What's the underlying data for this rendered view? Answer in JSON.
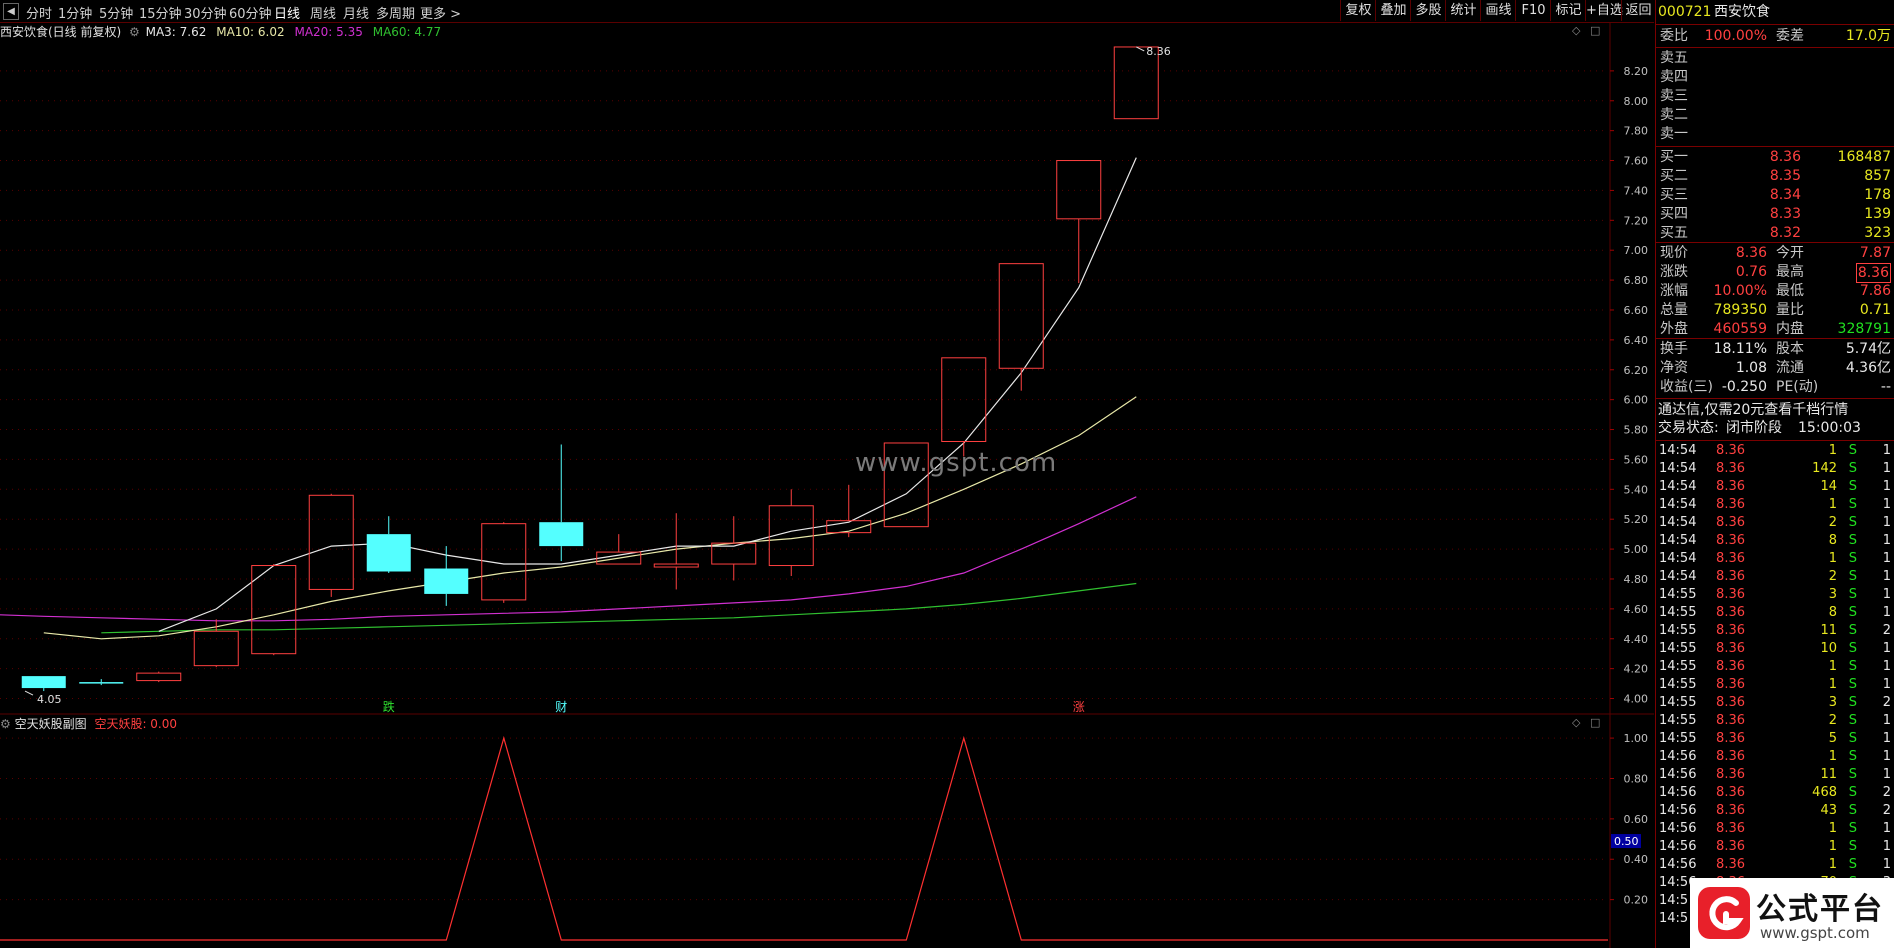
{
  "toolbar": {
    "periods": [
      "分时",
      "1分钟",
      "5分钟",
      "15分钟",
      "30分钟",
      "60分钟",
      "日线",
      "周线",
      "月线",
      "多周期",
      "更多 >"
    ],
    "actions": [
      "复权",
      "叠加",
      "多股",
      "统计",
      "画线",
      "F10",
      "标记",
      "+自选",
      "返回"
    ]
  },
  "chart": {
    "stock_title": "西安饮食(日线 前复权)",
    "ma3_label": "MA3: 7.62",
    "ma10_label": "MA10: 6.02",
    "ma20_label": "MA20: 5.35",
    "ma60_label": "MA60: 4.77",
    "high_marker": "8.36",
    "low_marker": "4.05",
    "event_labels": [
      "跌",
      "财",
      "涨"
    ],
    "y_ticks": [
      "8.20",
      "8.00",
      "7.80",
      "7.60",
      "7.40",
      "7.20",
      "7.00",
      "6.80",
      "6.60",
      "6.40",
      "6.20",
      "6.00",
      "5.80",
      "5.60",
      "5.40",
      "5.20",
      "5.00",
      "4.80",
      "4.60",
      "4.40",
      "4.20",
      "4.00"
    ],
    "colors": {
      "up": "#ff4040",
      "down": "#54ffff",
      "ma3": "#e8e8e8",
      "ma10": "#e8e8a8",
      "ma20": "#d030d0",
      "ma60": "#30c030",
      "grid": "#5a0000"
    }
  },
  "indicator": {
    "title": "空天妖股副图",
    "series_label": "空天妖股: 0.00",
    "y_ticks": [
      "1.00",
      "0.80",
      "0.60",
      "0.40",
      "0.20"
    ],
    "cursor_value": "0.50"
  },
  "watermark": "www.gspt.com",
  "logo": {
    "text": "公式平台",
    "url": "www.gspt.com"
  },
  "chart_data": [
    {
      "type": "candlestick",
      "title": "西安饮食(日线 前复权)",
      "candles": [
        {
          "o": 4.15,
          "h": 4.15,
          "l": 4.05,
          "c": 4.07
        },
        {
          "o": 4.11,
          "h": 4.13,
          "l": 4.09,
          "c": 4.1
        },
        {
          "o": 4.12,
          "h": 4.18,
          "l": 4.11,
          "c": 4.17
        },
        {
          "o": 4.22,
          "h": 4.53,
          "l": 4.21,
          "c": 4.45
        },
        {
          "o": 4.3,
          "h": 4.9,
          "l": 4.29,
          "c": 4.89
        },
        {
          "o": 4.73,
          "h": 5.37,
          "l": 4.68,
          "c": 5.36
        },
        {
          "o": 5.1,
          "h": 5.22,
          "l": 4.84,
          "c": 4.85
        },
        {
          "o": 4.87,
          "h": 5.02,
          "l": 4.62,
          "c": 4.7
        },
        {
          "o": 4.66,
          "h": 5.18,
          "l": 4.64,
          "c": 5.17
        },
        {
          "o": 5.18,
          "h": 5.7,
          "l": 4.92,
          "c": 5.02
        },
        {
          "o": 4.9,
          "h": 5.1,
          "l": 4.9,
          "c": 4.98
        },
        {
          "o": 4.88,
          "h": 5.24,
          "l": 4.73,
          "c": 4.9
        },
        {
          "o": 4.9,
          "h": 5.22,
          "l": 4.79,
          "c": 5.04
        },
        {
          "o": 4.89,
          "h": 5.4,
          "l": 4.82,
          "c": 5.29
        },
        {
          "o": 5.11,
          "h": 5.43,
          "l": 5.08,
          "c": 5.19
        },
        {
          "o": 5.15,
          "h": 5.71,
          "l": 5.15,
          "c": 5.71
        },
        {
          "o": 5.72,
          "h": 6.28,
          "l": 5.62,
          "c": 6.28
        },
        {
          "o": 6.21,
          "h": 6.91,
          "l": 6.06,
          "c": 6.91
        },
        {
          "o": 7.21,
          "h": 7.6,
          "l": 6.78,
          "c": 7.6
        },
        {
          "o": 7.88,
          "h": 8.36,
          "l": 7.88,
          "c": 8.36
        }
      ],
      "ma3": [
        4.45,
        4.6,
        4.89,
        5.02,
        5.04,
        4.96,
        4.9,
        4.9,
        4.96,
        5.02,
        5.02,
        5.12,
        5.18,
        5.37,
        5.71,
        6.18,
        6.75,
        7.62
      ],
      "ma10": [
        4.44,
        4.4,
        4.42,
        4.48,
        4.56,
        4.65,
        4.72,
        4.78,
        4.84,
        4.88,
        4.94,
        5.0,
        5.04,
        5.07,
        5.12,
        5.24,
        5.4,
        5.57,
        5.76,
        6.02
      ],
      "ma20": [
        4.56,
        4.55,
        4.54,
        4.53,
        4.52,
        4.52,
        4.53,
        4.55,
        4.56,
        4.57,
        4.58,
        4.6,
        4.62,
        4.64,
        4.66,
        4.7,
        4.75,
        4.84,
        5.0,
        5.17,
        5.35
      ],
      "ma60": [
        4.44,
        4.45,
        4.46,
        4.46,
        4.47,
        4.48,
        4.49,
        4.5,
        4.51,
        4.52,
        4.53,
        4.54,
        4.56,
        4.58,
        4.6,
        4.63,
        4.67,
        4.72,
        4.77
      ],
      "ylim": [
        3.95,
        8.42
      ]
    },
    {
      "type": "line",
      "title": "空天妖股副图",
      "series": [
        {
          "name": "空天妖股",
          "values": [
            0,
            0,
            0,
            0,
            0,
            0,
            0,
            0,
            1,
            0,
            0,
            0,
            0,
            0,
            0,
            0,
            1,
            0,
            0,
            0
          ]
        }
      ],
      "ylim": [
        0,
        1.05
      ]
    }
  ],
  "panel": {
    "code": "000721",
    "name": "西安饮食",
    "weibi_label": "委比",
    "weibi_value": "100.00%",
    "weicha_label": "委差",
    "weicha_value": "17.0万",
    "sells": [
      {
        "label": "卖五",
        "price": "",
        "vol": ""
      },
      {
        "label": "卖四",
        "price": "",
        "vol": ""
      },
      {
        "label": "卖三",
        "price": "",
        "vol": ""
      },
      {
        "label": "卖二",
        "price": "",
        "vol": ""
      },
      {
        "label": "卖一",
        "price": "",
        "vol": ""
      }
    ],
    "buys": [
      {
        "label": "买一",
        "price": "8.36",
        "vol": "168487"
      },
      {
        "label": "买二",
        "price": "8.35",
        "vol": "857"
      },
      {
        "label": "买三",
        "price": "8.34",
        "vol": "178"
      },
      {
        "label": "买四",
        "price": "8.33",
        "vol": "139"
      },
      {
        "label": "买五",
        "price": "8.32",
        "vol": "323"
      }
    ],
    "quote": [
      {
        "l1": "现价",
        "v1": "8.36",
        "l2": "今开",
        "v2": "7.87",
        "c1": "red",
        "c2": "red"
      },
      {
        "l1": "涨跌",
        "v1": "0.76",
        "l2": "最高",
        "v2": "8.36",
        "c1": "red",
        "c2": "red"
      },
      {
        "l1": "涨幅",
        "v1": "10.00%",
        "l2": "最低",
        "v2": "7.86",
        "c1": "red",
        "c2": "red"
      },
      {
        "l1": "总量",
        "v1": "789350",
        "l2": "量比",
        "v2": "0.71",
        "c1": "yellow",
        "c2": "yellow"
      },
      {
        "l1": "外盘",
        "v1": "460559",
        "l2": "内盘",
        "v2": "328791",
        "c1": "red",
        "c2": "green"
      }
    ],
    "fund": [
      {
        "l1": "换手",
        "v1": "18.11%",
        "l2": "股本",
        "v2": "5.74亿"
      },
      {
        "l1": "净资",
        "v1": "1.08",
        "l2": "流通",
        "v2": "4.36亿"
      },
      {
        "l1": "收益(三)",
        "v1": "-0.250",
        "l2": "PE(动)",
        "v2": "--"
      }
    ],
    "promo": "通达信,仅需20元查看千档行情",
    "trade_status_label": "交易状态:",
    "trade_status": "闭市阶段",
    "trade_time": "15:00:03",
    "ticks": [
      {
        "t": "14:54",
        "p": "8.36",
        "v": "1",
        "s": "S",
        "n": "1"
      },
      {
        "t": "14:54",
        "p": "8.36",
        "v": "142",
        "s": "S",
        "n": "1"
      },
      {
        "t": "14:54",
        "p": "8.36",
        "v": "14",
        "s": "S",
        "n": "1"
      },
      {
        "t": "14:54",
        "p": "8.36",
        "v": "1",
        "s": "S",
        "n": "1"
      },
      {
        "t": "14:54",
        "p": "8.36",
        "v": "2",
        "s": "S",
        "n": "1"
      },
      {
        "t": "14:54",
        "p": "8.36",
        "v": "8",
        "s": "S",
        "n": "1"
      },
      {
        "t": "14:54",
        "p": "8.36",
        "v": "1",
        "s": "S",
        "n": "1"
      },
      {
        "t": "14:54",
        "p": "8.36",
        "v": "2",
        "s": "S",
        "n": "1"
      },
      {
        "t": "14:55",
        "p": "8.36",
        "v": "3",
        "s": "S",
        "n": "1"
      },
      {
        "t": "14:55",
        "p": "8.36",
        "v": "8",
        "s": "S",
        "n": "1"
      },
      {
        "t": "14:55",
        "p": "8.36",
        "v": "11",
        "s": "S",
        "n": "2"
      },
      {
        "t": "14:55",
        "p": "8.36",
        "v": "10",
        "s": "S",
        "n": "1"
      },
      {
        "t": "14:55",
        "p": "8.36",
        "v": "1",
        "s": "S",
        "n": "1"
      },
      {
        "t": "14:55",
        "p": "8.36",
        "v": "1",
        "s": "S",
        "n": "1"
      },
      {
        "t": "14:55",
        "p": "8.36",
        "v": "3",
        "s": "S",
        "n": "2"
      },
      {
        "t": "14:55",
        "p": "8.36",
        "v": "2",
        "s": "S",
        "n": "1"
      },
      {
        "t": "14:55",
        "p": "8.36",
        "v": "5",
        "s": "S",
        "n": "1"
      },
      {
        "t": "14:56",
        "p": "8.36",
        "v": "1",
        "s": "S",
        "n": "1"
      },
      {
        "t": "14:56",
        "p": "8.36",
        "v": "11",
        "s": "S",
        "n": "1"
      },
      {
        "t": "14:56",
        "p": "8.36",
        "v": "468",
        "s": "S",
        "n": "2"
      },
      {
        "t": "14:56",
        "p": "8.36",
        "v": "43",
        "s": "S",
        "n": "2"
      },
      {
        "t": "14:56",
        "p": "8.36",
        "v": "1",
        "s": "S",
        "n": "1"
      },
      {
        "t": "14:56",
        "p": "8.36",
        "v": "1",
        "s": "S",
        "n": "1"
      },
      {
        "t": "14:56",
        "p": "8.36",
        "v": "1",
        "s": "S",
        "n": "1"
      },
      {
        "t": "14:56",
        "p": "8.36",
        "v": "70",
        "s": "S",
        "n": "3"
      },
      {
        "t": "14:5",
        "p": "8.36",
        "v": "",
        "s": "",
        "n": "1"
      },
      {
        "t": "14:5",
        "p": "8.36",
        "v": "",
        "s": "",
        "n": "2"
      }
    ]
  }
}
